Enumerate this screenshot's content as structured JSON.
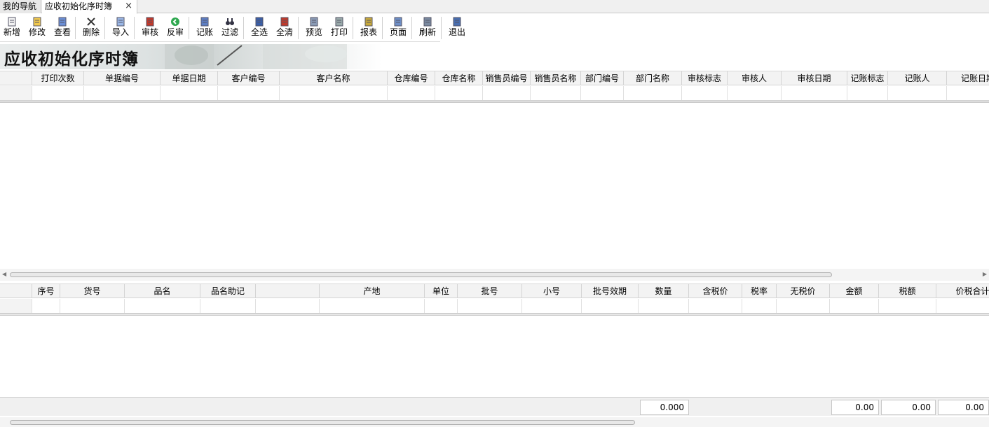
{
  "tabs": {
    "nav": "我的导航",
    "active": "应收初始化序时簿",
    "close_glyph": "×"
  },
  "toolbar": [
    {
      "key": "new",
      "label": "新增",
      "icon": "new-doc-icon"
    },
    {
      "key": "edit",
      "label": "修改",
      "icon": "edit-icon"
    },
    {
      "key": "view",
      "label": "查看",
      "icon": "view-icon"
    },
    {
      "key": "delete",
      "label": "删除",
      "icon": "delete-icon"
    },
    {
      "key": "import",
      "label": "导入",
      "icon": "import-icon"
    },
    {
      "key": "audit",
      "label": "审核",
      "icon": "audit-icon"
    },
    {
      "key": "unaudit",
      "label": "反审",
      "icon": "unaudit-icon"
    },
    {
      "key": "post",
      "label": "记账",
      "icon": "post-icon"
    },
    {
      "key": "filter",
      "label": "过滤",
      "icon": "filter-icon"
    },
    {
      "key": "selectall",
      "label": "全选",
      "icon": "select-all-icon"
    },
    {
      "key": "clearall",
      "label": "全清",
      "icon": "clear-all-icon"
    },
    {
      "key": "preview",
      "label": "预览",
      "icon": "preview-icon"
    },
    {
      "key": "print",
      "label": "打印",
      "icon": "print-icon"
    },
    {
      "key": "report",
      "label": "报表",
      "icon": "report-icon"
    },
    {
      "key": "page",
      "label": "页面",
      "icon": "page-icon"
    },
    {
      "key": "refresh",
      "label": "刷新",
      "icon": "refresh-icon"
    },
    {
      "key": "exit",
      "label": "退出",
      "icon": "exit-icon"
    }
  ],
  "banner": {
    "title": "应收初始化序时簿"
  },
  "master_grid": {
    "columns": [
      "打印次数",
      "单据编号",
      "单据日期",
      "客户编号",
      "客户名称",
      "仓库编号",
      "仓库名称",
      "销售员编号",
      "销售员名称",
      "部门编号",
      "部门名称",
      "审核标志",
      "审核人",
      "审核日期",
      "记账标志",
      "记账人",
      "记账日期"
    ]
  },
  "detail_grid": {
    "columns": [
      "序号",
      "货号",
      "品名",
      "品名助记",
      "",
      "产地",
      "单位",
      "批号",
      "小号",
      "批号效期",
      "数量",
      "含税价",
      "税率",
      "无税价",
      "金额",
      "税额",
      "价税合计"
    ]
  },
  "footer": {
    "qty_total": "0.000",
    "amount_total": "0.00",
    "tax_total": "0.00",
    "gross_total": "0.00"
  },
  "colors": {
    "tab_active_bg": "#ffffff",
    "grid_header_bg": "#f3f3f3",
    "footer_bg": "#f0f0f0"
  }
}
